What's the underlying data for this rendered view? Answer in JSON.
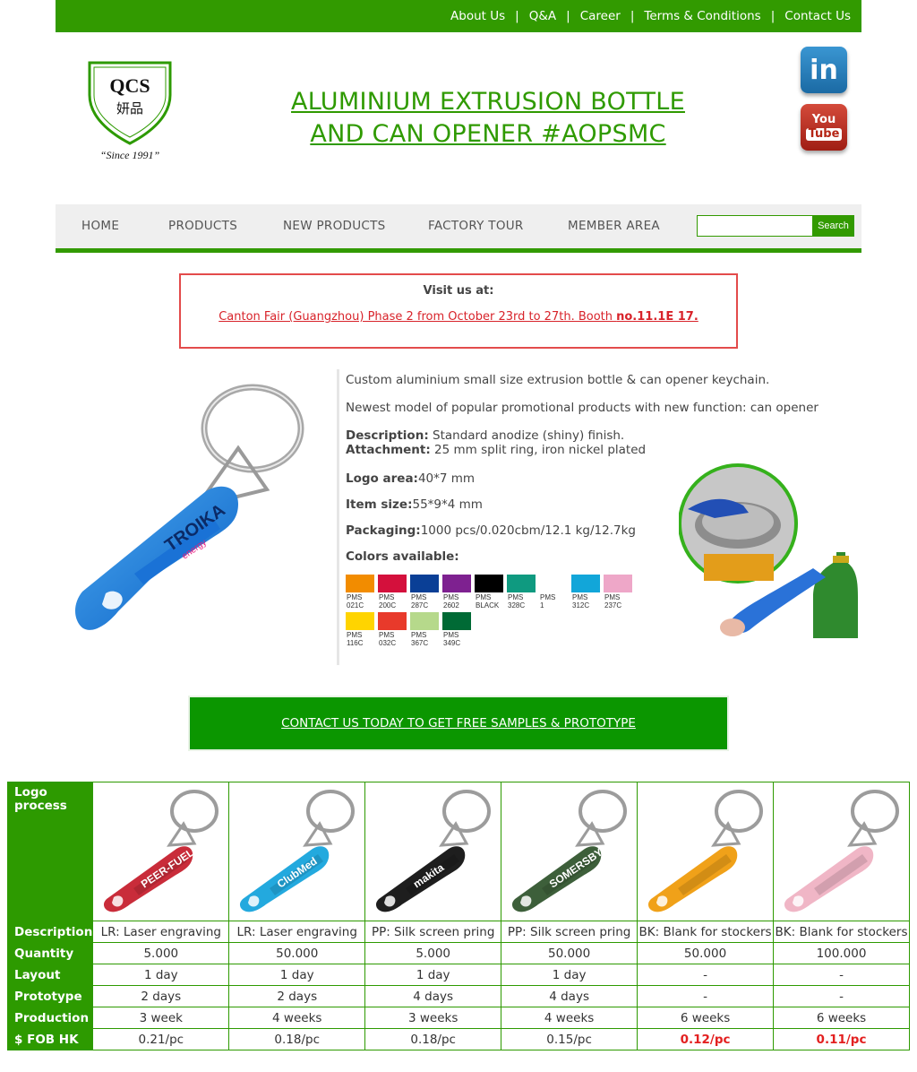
{
  "top_nav": [
    "About Us",
    "Q&A",
    "Career",
    "Terms & Conditions",
    "Contact Us"
  ],
  "logo": {
    "initials": "QCS",
    "chinese": "妍品",
    "since": "“Since 1991”"
  },
  "headline": [
    "ALUMINIUM EXTRUSION BOTTLE",
    "AND CAN OPENER #AOPSMC"
  ],
  "social": {
    "linkedin": "in",
    "youtube_1": "You",
    "youtube_2": "Tube"
  },
  "nav": {
    "items": [
      "HOME",
      "PRODUCTS",
      "NEW PRODUCTS",
      "FACTORY TOUR",
      "MEMBER AREA"
    ],
    "search_button": "Search",
    "search_value": ""
  },
  "visit": {
    "title": "Visit us at:",
    "text": "Canton Fair (Guangzhou) Phase 2 from October 23rd to 27th. Booth ",
    "booth": "no.11.1E 17."
  },
  "product": {
    "image_text": {
      "brand": "TROIKA",
      "sub": "energy"
    },
    "intro": "Custom aluminium small size extrusion bottle & can opener keychain.",
    "newest": "Newest model of popular promotional products with new function: can opener",
    "description_label": "Description:",
    "description": " Standard anodize (shiny) finish.",
    "attachment_label": "Attachment:",
    "attachment": " 25 mm split ring, iron nickel plated",
    "logo_area_label": "Logo area:",
    "logo_area": "40*7 mm",
    "item_size_label": "Item size:",
    "item_size": "55*9*4 mm",
    "packaging_label": "Packaging:",
    "packaging": "1000 pcs/0.020cbm/12.1 kg/12.7kg",
    "colors_label": "Colors available:"
  },
  "colors": [
    {
      "l1": "PMS",
      "l2": "021C",
      "hex": "#f28c00"
    },
    {
      "l1": "PMS",
      "l2": "200C",
      "hex": "#d4103c"
    },
    {
      "l1": "PMS",
      "l2": "287C",
      "hex": "#0a3f96"
    },
    {
      "l1": "PMS",
      "l2": "2602",
      "hex": "#7e2190"
    },
    {
      "l1": "PMS",
      "l2": "BLACK",
      "hex": "#000000"
    },
    {
      "l1": "PMS",
      "l2": "328C",
      "hex": "#0f9a80"
    },
    {
      "l1": "PMS",
      "l2": "1",
      "hex": "#ffffff"
    },
    {
      "l1": "PMS",
      "l2": "312C",
      "hex": "#12a6d9"
    },
    {
      "l1": "PMS",
      "l2": "237C",
      "hex": "#eea7c8"
    },
    {
      "l1": "PMS",
      "l2": "116C",
      "hex": "#ffd400"
    },
    {
      "l1": "PMS",
      "l2": "032C",
      "hex": "#e83a2b"
    },
    {
      "l1": "PMS",
      "l2": "367C",
      "hex": "#b6d98b"
    },
    {
      "l1": "PMS",
      "l2": "349C",
      "hex": "#006a35"
    }
  ],
  "cta": "CONTACT US TODAY TO GET FREE SAMPLES & PROTOTYPE",
  "table": {
    "header_logo": "Logo process",
    "row_labels": [
      "Description",
      "Quantity",
      "Layout",
      "Prototype",
      "Production",
      "$ FOB HK"
    ],
    "columns": [
      {
        "brand": "PEER-FUEL",
        "color": "#c92c3a",
        "description": "LR: Laser engraving",
        "quantity": "5.000",
        "layout": "1 day",
        "prototype": "2 days",
        "production": "3 week",
        "price": "0.21/pc"
      },
      {
        "brand": "ClubMed",
        "color": "#23a9de",
        "description": "LR: Laser engraving",
        "quantity": "50.000",
        "layout": "1 day",
        "prototype": "2 days",
        "production": "4 weeks",
        "price": "0.18/pc"
      },
      {
        "brand": "makita",
        "color": "#1e1e1e",
        "description": "PP: Silk screen pring",
        "quantity": "5.000",
        "layout": "1 day",
        "prototype": "4 days",
        "production": "3 weeks",
        "price": "0.18/pc"
      },
      {
        "brand": "SOMERSBY",
        "color": "#3d5f3a",
        "description": "PP: Silk screen pring",
        "quantity": "50.000",
        "layout": "1 day",
        "prototype": "4 days",
        "production": "4 weeks",
        "price": "0.15/pc"
      },
      {
        "brand": "",
        "color": "#f0a119",
        "description": "BK: Blank for stockers",
        "quantity": "50.000",
        "layout": "-",
        "prototype": "-",
        "production": "6 weeks",
        "price": "0.12/pc"
      },
      {
        "brand": "",
        "color": "#f0b6c6",
        "description": "BK: Blank for stockers",
        "quantity": "100.000",
        "layout": "-",
        "prototype": "-",
        "production": "6 weeks",
        "price": "0.11/pc"
      }
    ]
  }
}
